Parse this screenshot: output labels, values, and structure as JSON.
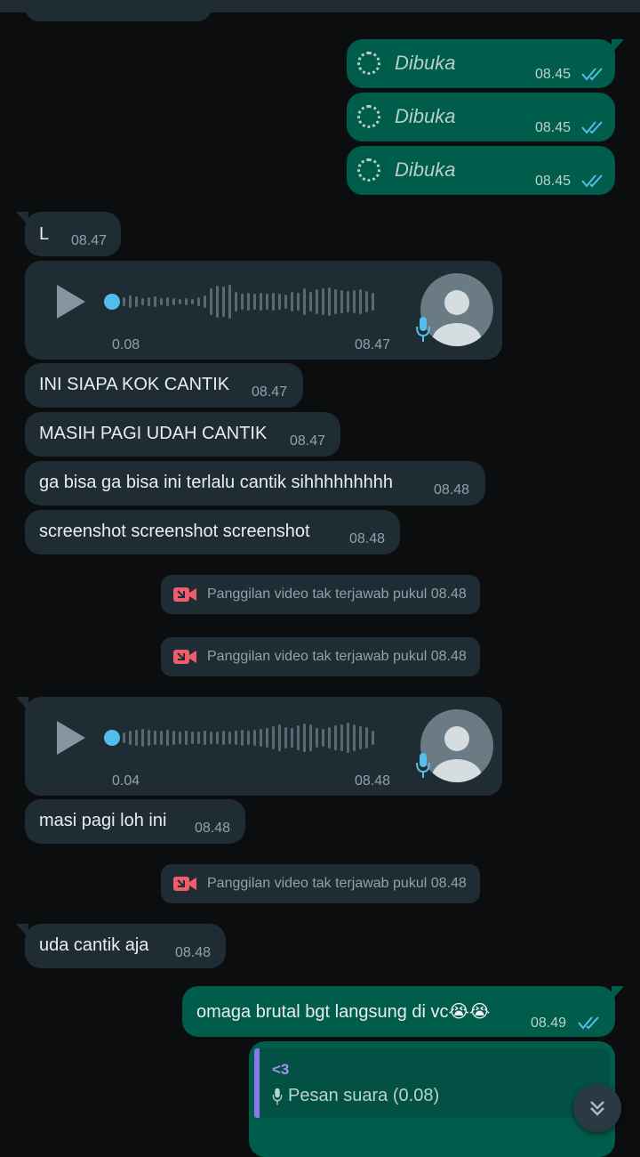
{
  "messages": {
    "dibuka_1": {
      "text": "Dibuka",
      "time": "08.45"
    },
    "dibuka_2": {
      "text": "Dibuka",
      "time": "08.45"
    },
    "dibuka_3": {
      "text": "Dibuka",
      "time": "08.45"
    },
    "in_l": {
      "text": "L",
      "time": "08.47"
    },
    "voice_1": {
      "duration": "0.08",
      "time": "08.47"
    },
    "in_2": {
      "text": "INI SIAPA KOK CANTIK",
      "time": "08.47"
    },
    "in_3": {
      "text": "MASIH PAGI UDAH CANTIK",
      "time": "08.47"
    },
    "in_4": {
      "text": "ga bisa ga bisa ini terlalu cantik sihhhhhhhhh",
      "time": "08.48"
    },
    "in_5": {
      "text": "screenshot screenshot screenshot",
      "time": "08.48"
    },
    "sys_1": {
      "text": "Panggilan video tak terjawab pukul 08.48"
    },
    "sys_2": {
      "text": "Panggilan video tak terjawab pukul 08.48"
    },
    "voice_2": {
      "duration": "0.04",
      "time": "08.48"
    },
    "in_6": {
      "text": "masi pagi loh ini",
      "time": "08.48"
    },
    "sys_3": {
      "text": "Panggilan video tak terjawab pukul 08.48"
    },
    "in_7": {
      "text": "uda cantik aja",
      "time": "08.48"
    },
    "out_1": {
      "text": "omaga brutal bgt langsung di vc😭😭",
      "time": "08.49"
    },
    "reply": {
      "sender": "<3",
      "quoted": "Pesan suara (0.08)"
    }
  },
  "colors": {
    "incoming": "#1f2c34",
    "outgoing": "#005c4b",
    "tick": "#53bdeb",
    "missed_call": "#f15c6d"
  },
  "icons": [
    "play-icon",
    "mic-icon",
    "avatar-icon",
    "video-missed-icon",
    "double-check-icon",
    "chevron-double-down-icon"
  ]
}
